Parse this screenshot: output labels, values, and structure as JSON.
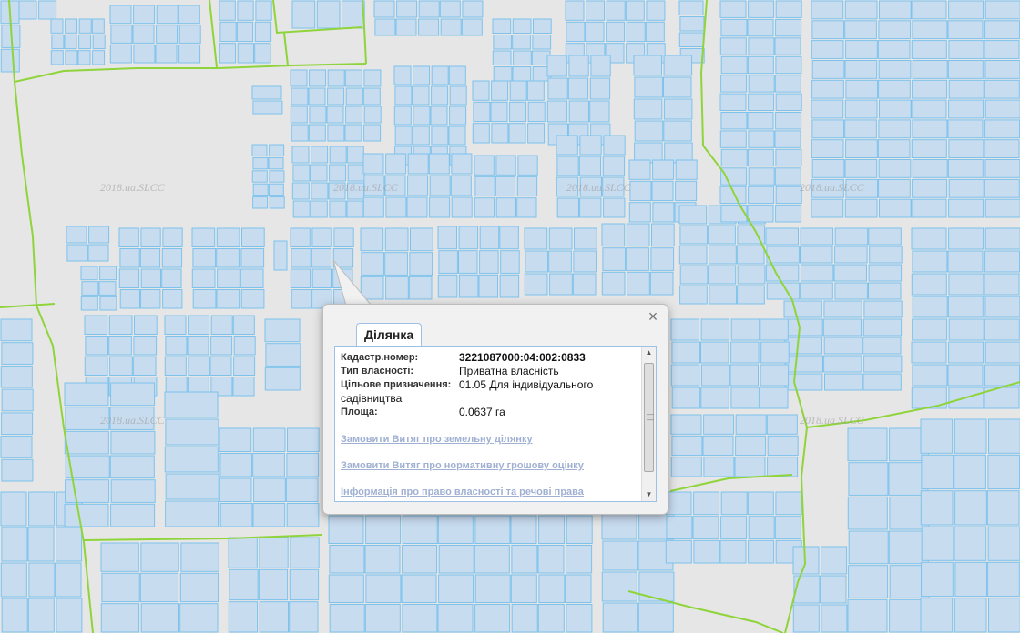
{
  "map": {
    "watermark_text": "2018.ua.SLCC",
    "colors": {
      "background": "#e6e6e6",
      "parcel_fill": "#c8dcf0",
      "parcel_stroke": "#7ec2ec",
      "boundary": "#8fd43a"
    }
  },
  "popup": {
    "tab_label": "Ділянка",
    "close_icon": "close-icon",
    "fields": [
      {
        "label": "Кадастр.номер:",
        "value": "3221087000:04:002:0833"
      },
      {
        "label": "Тип власності:",
        "value": "Приватна власність"
      },
      {
        "label": "Цільове призначення:",
        "value": "01.05 Для індивідуального",
        "value_cont": "садівництва"
      },
      {
        "label": "Площа:",
        "value": "0.0637 га"
      }
    ],
    "links": [
      "Замовити Витяг про земельну ділянку",
      "Замовити Витяг про нормативну грошову оцінку",
      "Інформація про право власності та речові права"
    ],
    "scroll_position": 0
  }
}
